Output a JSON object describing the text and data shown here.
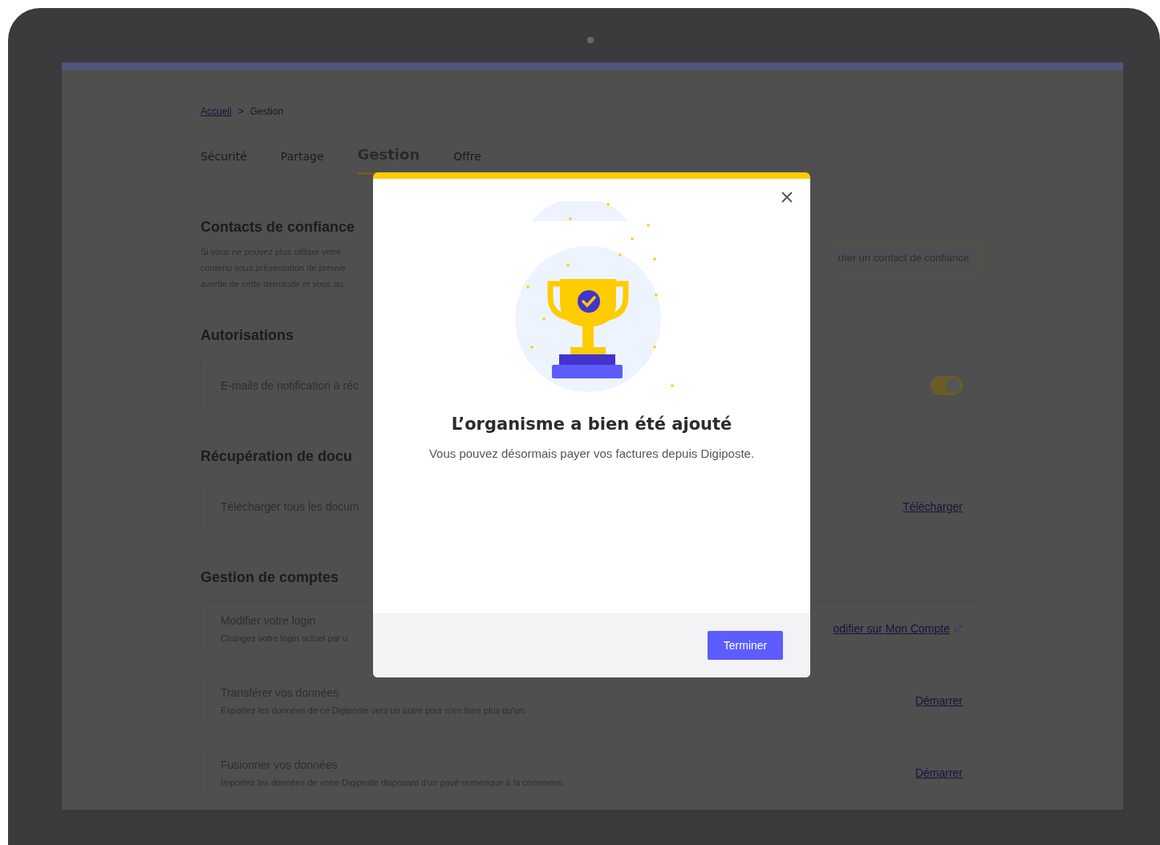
{
  "breadcrumb": {
    "items": [
      {
        "label": "Accueil",
        "kind": "link"
      },
      {
        "label": "Gestion",
        "kind": "current"
      }
    ],
    "separator": ">"
  },
  "tabs": [
    {
      "label": "Sécurité",
      "selected": false
    },
    {
      "label": "Partage",
      "selected": false
    },
    {
      "label": "Gestion",
      "selected": true
    },
    {
      "label": "Offre",
      "selected": false
    }
  ],
  "sections": [
    {
      "title": "Contacts de confiance",
      "description": [
        "Si vous ne pouvez plus utiliser votre",
        "contenu sous présentation de preuve",
        "avertie de cette demande et vous au"
      ],
      "action": "uter un contact de confiance"
    },
    {
      "title": "Autorisations",
      "cards": [
        {
          "kind": "toggle",
          "label": "E-mails de notification à réc",
          "on": true
        }
      ]
    },
    {
      "title": "Récupération de docu",
      "cards": [
        {
          "kind": "link",
          "label": "Télécharger tous les docum",
          "link": "Télécharger"
        }
      ]
    },
    {
      "title": "Gestion de comptes",
      "cards": [
        {
          "kind": "external-link",
          "label": "Modifier votre login",
          "description": "Changez votre login actuel par u",
          "link": "odifier sur Mon Compte"
        },
        {
          "kind": "link",
          "label": "Transférer vos données",
          "description": "Exportez les données de ce Digiposte vers un autre pour n'en faire plus qu'un.",
          "link": "Démarrer"
        },
        {
          "kind": "link",
          "label": "Fusionner vos données",
          "description": "Importez les données de votre Digiposte disposant d'un pavé numérique à la connexion.",
          "link": "Démarrer"
        }
      ]
    }
  ],
  "modal": {
    "title": "L’organisme a bien été ajouté",
    "message": "Vous pouvez désormais payer vos factures depuis Digiposte.",
    "button": "Terminer"
  }
}
